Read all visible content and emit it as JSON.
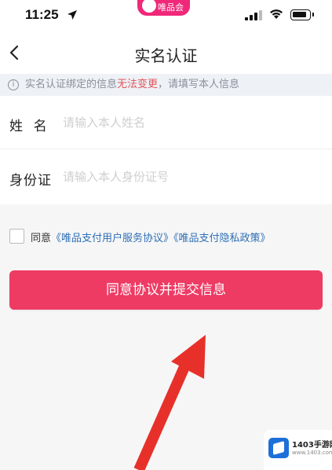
{
  "status_bar": {
    "time": "11:25",
    "app_badge": "唯品会"
  },
  "nav": {
    "title": "实名认证"
  },
  "notice": {
    "text_before": "实名认证绑定的信息",
    "text_highlight": "无法变更",
    "text_after": "，请填写本人信息"
  },
  "form": {
    "name_label": "姓  名",
    "name_placeholder": "请输入本人姓名",
    "id_label": "身份证",
    "id_placeholder": "请输入本人身份证号"
  },
  "agreement": {
    "prefix": "同意",
    "link_service": "《唯品支付用户服务协议》",
    "link_privacy": "《唯品支付隐私政策》"
  },
  "submit_label": "同意协议并提交信息",
  "watermark": {
    "text": "1403手游网",
    "sub": "www.1403.com"
  },
  "colors": {
    "accent": "#ee3b64",
    "link": "#2f6fb6",
    "warning": "#e0565b",
    "annotation_arrow": "#e8302a"
  }
}
